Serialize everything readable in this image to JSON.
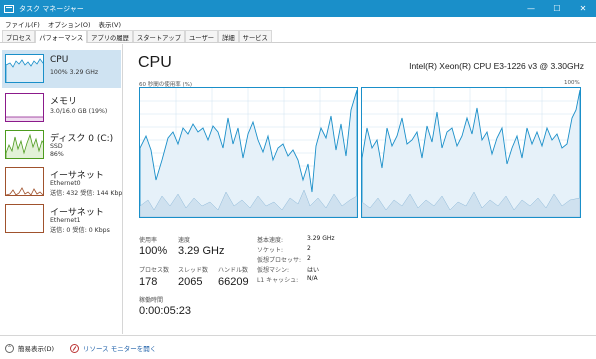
{
  "window": {
    "title": "タスク マネージャー"
  },
  "menu": [
    "ファイル(F)",
    "オプション(O)",
    "表示(V)"
  ],
  "tabs": [
    "プロセス",
    "パフォーマンス",
    "アプリの履歴",
    "スタートアップ",
    "ユーザー",
    "詳細",
    "サービス"
  ],
  "active_tab": "パフォーマンス",
  "sidebar": {
    "items": [
      {
        "title": "CPU",
        "line1": "100%  3.29 GHz",
        "line2": "",
        "selected": true,
        "color": "#1a8fc9"
      },
      {
        "title": "メモリ",
        "line1": "3.0/16.0 GB (19%)",
        "line2": "",
        "selected": false,
        "color": "#8b1a8b"
      },
      {
        "title": "ディスク 0 (C:)",
        "line1": "SSD",
        "line2": "86%",
        "selected": false,
        "color": "#4d9b1e"
      },
      {
        "title": "イーサネット",
        "line1": "Ethernet0",
        "line2": "送信: 432  受信: 144 Kbp",
        "selected": false,
        "color": "#a0522d"
      },
      {
        "title": "イーサネット",
        "line1": "Ethernet1",
        "line2": "送信: 0  受信: 0 Kbps",
        "selected": false,
        "color": "#a0522d"
      }
    ]
  },
  "main": {
    "title": "CPU",
    "processor": "Intel(R) Xeon(R) CPU E3-1226 v3 @ 3.30GHz",
    "axis_left": "60 秒間の使用率 (%)",
    "axis_right": "100%",
    "stats": {
      "util_label": "使用率",
      "util_value": "100%",
      "speed_label": "速度",
      "speed_value": "3.29 GHz",
      "proc_label": "プロセス数",
      "proc_value": "178",
      "thread_label": "スレッド数",
      "thread_value": "2065",
      "handle_label": "ハンドル数",
      "handle_value": "66209",
      "uptime_label": "稼働時間",
      "uptime_value": "0:00:05:23"
    },
    "details": [
      {
        "label": "基本速度:",
        "value": "3.29 GHz"
      },
      {
        "label": "ソケット:",
        "value": "2"
      },
      {
        "label": "仮想プロセッサ:",
        "value": "2"
      },
      {
        "label": "仮想マシン:",
        "value": "はい"
      },
      {
        "label": "L1 キャッシュ:",
        "value": "N/A"
      }
    ]
  },
  "footer": {
    "fewer_details": "簡易表示(D)",
    "resource_monitor": "リソース モニターを開く"
  },
  "colors": {
    "accent": "#1a8fc9",
    "graph_fill": "#e6f1f9"
  }
}
